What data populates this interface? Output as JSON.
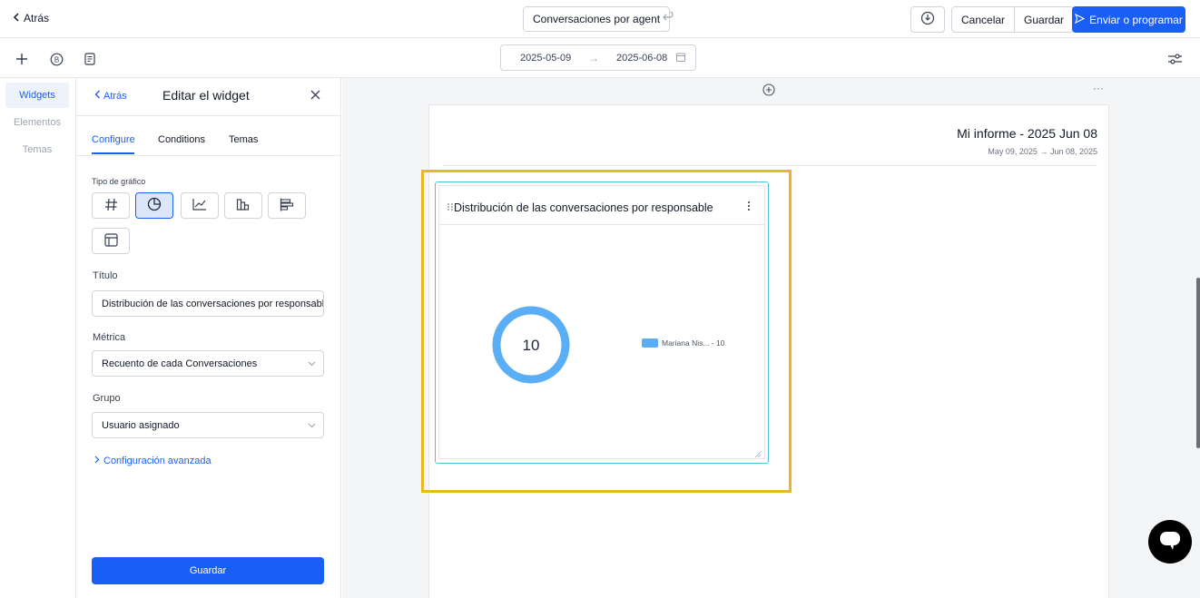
{
  "header": {
    "back_label": "Atrás",
    "report_name": "Conversaciones por agent",
    "cancel_label": "Cancelar",
    "save_label": "Guardar",
    "send_label": "Enviar o programar"
  },
  "date_range": {
    "start": "2025-05-09",
    "end": "2025-06-08"
  },
  "rail": {
    "items": [
      {
        "label": "Widgets"
      },
      {
        "label": "Elementos"
      },
      {
        "label": "Temas"
      }
    ]
  },
  "panel": {
    "back_label": "Atrás",
    "title": "Editar el widget",
    "tabs": [
      {
        "label": "Configure"
      },
      {
        "label": "Conditions"
      },
      {
        "label": "Temas"
      }
    ],
    "chart_type_label": "Tipo de gráfico",
    "chart_types": [
      "number-icon",
      "pie-chart-icon",
      "line-chart-icon",
      "bar-chart-icon",
      "horizontal-bar-icon",
      "table-icon"
    ],
    "title_label": "Título",
    "title_value": "Distribución de las conversaciones por responsable",
    "metric_label": "Métrica",
    "metric_value": "Recuento de cada Conversaciones",
    "group_label": "Grupo",
    "group_value": "Usuario asignado",
    "advanced_label": "Configuración avanzada",
    "save_label": "Guardar"
  },
  "report": {
    "title": "Mi informe - 2025 Jun 08",
    "subtitle": "May 09, 2025 → Jun 08, 2025"
  },
  "widget": {
    "title": "Distribución de las conversaciones por responsable",
    "total": "10",
    "legend_label": "Mariana Nis... - 10"
  },
  "chart_data": {
    "type": "pie",
    "categories": [
      "Mariana Nis..."
    ],
    "values": [
      10
    ],
    "title": "Distribución de las conversaciones por responsable",
    "center_value": 10,
    "colors": [
      "#5aaef5"
    ],
    "legend_position": "right"
  },
  "colors": {
    "accent": "#1a5ff5",
    "highlight": "#e8b820",
    "widget_border": "#4fc3dc",
    "series": "#5aaef5"
  }
}
